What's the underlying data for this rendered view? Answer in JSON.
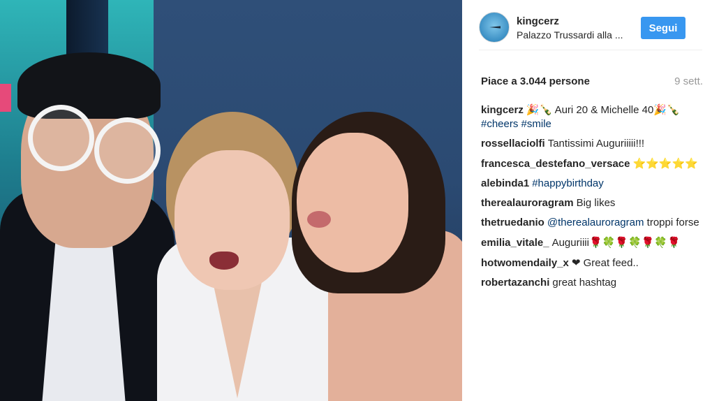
{
  "header": {
    "username": "kingcerz",
    "location": "Palazzo Trussardi alla ...",
    "follow_label": "Segui"
  },
  "stats": {
    "likes": "Piace a 3.044 persone",
    "time": "9 sett."
  },
  "comments": [
    {
      "author": "kingcerz",
      "parts": [
        {
          "t": "emoji",
          "v": "🎉",
          "c": "emo-party"
        },
        {
          "t": "emoji",
          "v": "🍾",
          "c": "emo-bottle"
        },
        {
          "t": "text",
          "v": " Auri 20 & Michelle 40"
        },
        {
          "t": "emoji",
          "v": "🎉",
          "c": "emo-party"
        },
        {
          "t": "emoji",
          "v": "🍾",
          "c": "emo-bottle"
        },
        {
          "t": "text",
          "v": " "
        },
        {
          "t": "tag",
          "v": "#cheers"
        },
        {
          "t": "text",
          "v": " "
        },
        {
          "t": "tag",
          "v": "#smile"
        }
      ]
    },
    {
      "author": "rossellaciolfi",
      "parts": [
        {
          "t": "text",
          "v": "Tantissimi Auguriiiii!!!"
        }
      ]
    },
    {
      "author": "francesca_destefano_versace",
      "parts": [
        {
          "t": "emoji",
          "v": "⭐⭐⭐⭐⭐",
          "c": "emo-gold"
        }
      ]
    },
    {
      "author": "alebinda1",
      "parts": [
        {
          "t": "tag",
          "v": "#happybirthday"
        }
      ]
    },
    {
      "author": "therealauroragram",
      "parts": [
        {
          "t": "text",
          "v": "Big likes"
        }
      ]
    },
    {
      "author": "thetruedanio",
      "parts": [
        {
          "t": "tag",
          "v": "@therealauroragram"
        },
        {
          "t": "text",
          "v": " troppi forse"
        }
      ]
    },
    {
      "author": "emilia_vitale_",
      "parts": [
        {
          "t": "text",
          "v": "Auguriiii"
        },
        {
          "t": "emoji",
          "v": "🌹",
          "c": "emo-red"
        },
        {
          "t": "emoji",
          "v": "🍀",
          "c": "emo-green"
        },
        {
          "t": "emoji",
          "v": "🌹",
          "c": "emo-red"
        },
        {
          "t": "emoji",
          "v": "🍀",
          "c": "emo-green"
        },
        {
          "t": "emoji",
          "v": "🌹",
          "c": "emo-red"
        },
        {
          "t": "emoji",
          "v": "🍀",
          "c": "emo-green"
        },
        {
          "t": "emoji",
          "v": "🌹",
          "c": "emo-red"
        }
      ]
    },
    {
      "author": "hotwomendaily_x",
      "parts": [
        {
          "t": "emoji",
          "v": "❤",
          "c": ""
        },
        {
          "t": "text",
          "v": " Great feed.."
        }
      ]
    },
    {
      "author": "robertazanchi",
      "parts": [
        {
          "t": "text",
          "v": "great hashtag"
        }
      ]
    }
  ],
  "colors": {
    "follow_button": "#3897f0",
    "hashtag": "#003569",
    "timestamp": "#999999"
  }
}
